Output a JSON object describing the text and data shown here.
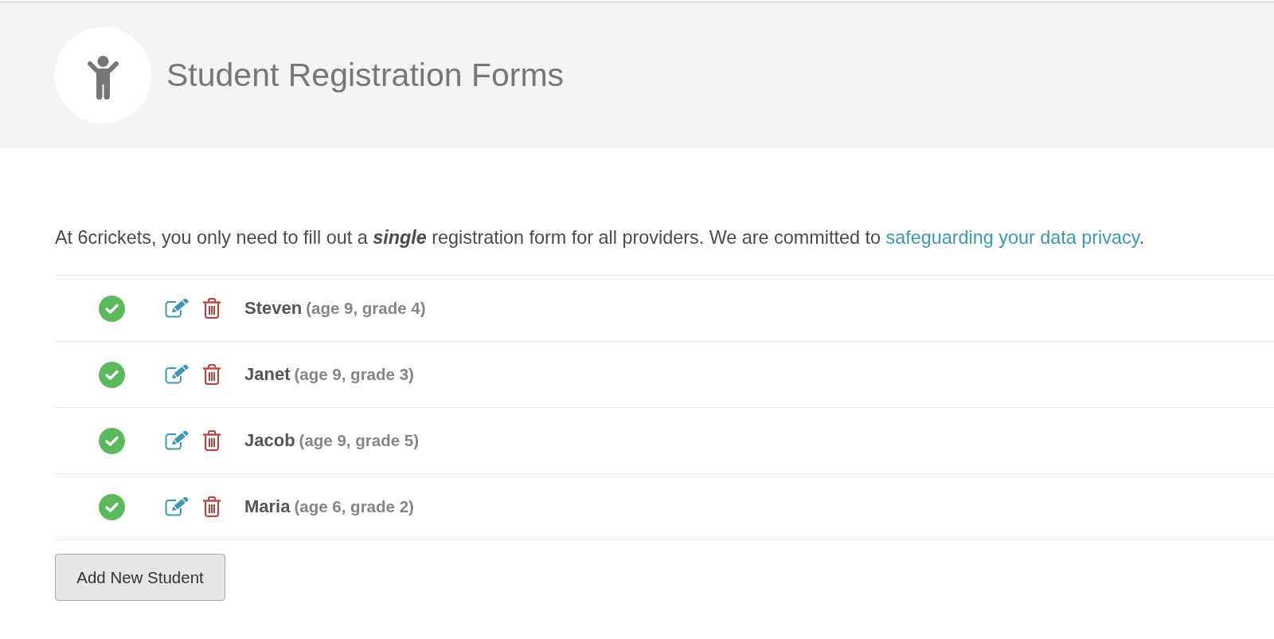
{
  "header": {
    "title": "Student Registration Forms"
  },
  "intro": {
    "text": "At 6crickets, you only need to fill out a *single* registration form for all providers. We are committed to ",
    "link": "safeguarding your data privacy",
    "text_end": "."
  },
  "students": [
    {
      "name": "Steven",
      "details": "(age 9, grade 4)",
      "complete": true
    },
    {
      "name": "Janet",
      "details": "(age 9, grade 3)",
      "complete": true
    },
    {
      "name": "Jacob",
      "details": "(age 9, grade 5)",
      "complete": true
    },
    {
      "name": "Maria",
      "details": "(age 6, grade 2)",
      "complete": true
    }
  ],
  "add_button": {
    "label": "Add New Student"
  }
}
